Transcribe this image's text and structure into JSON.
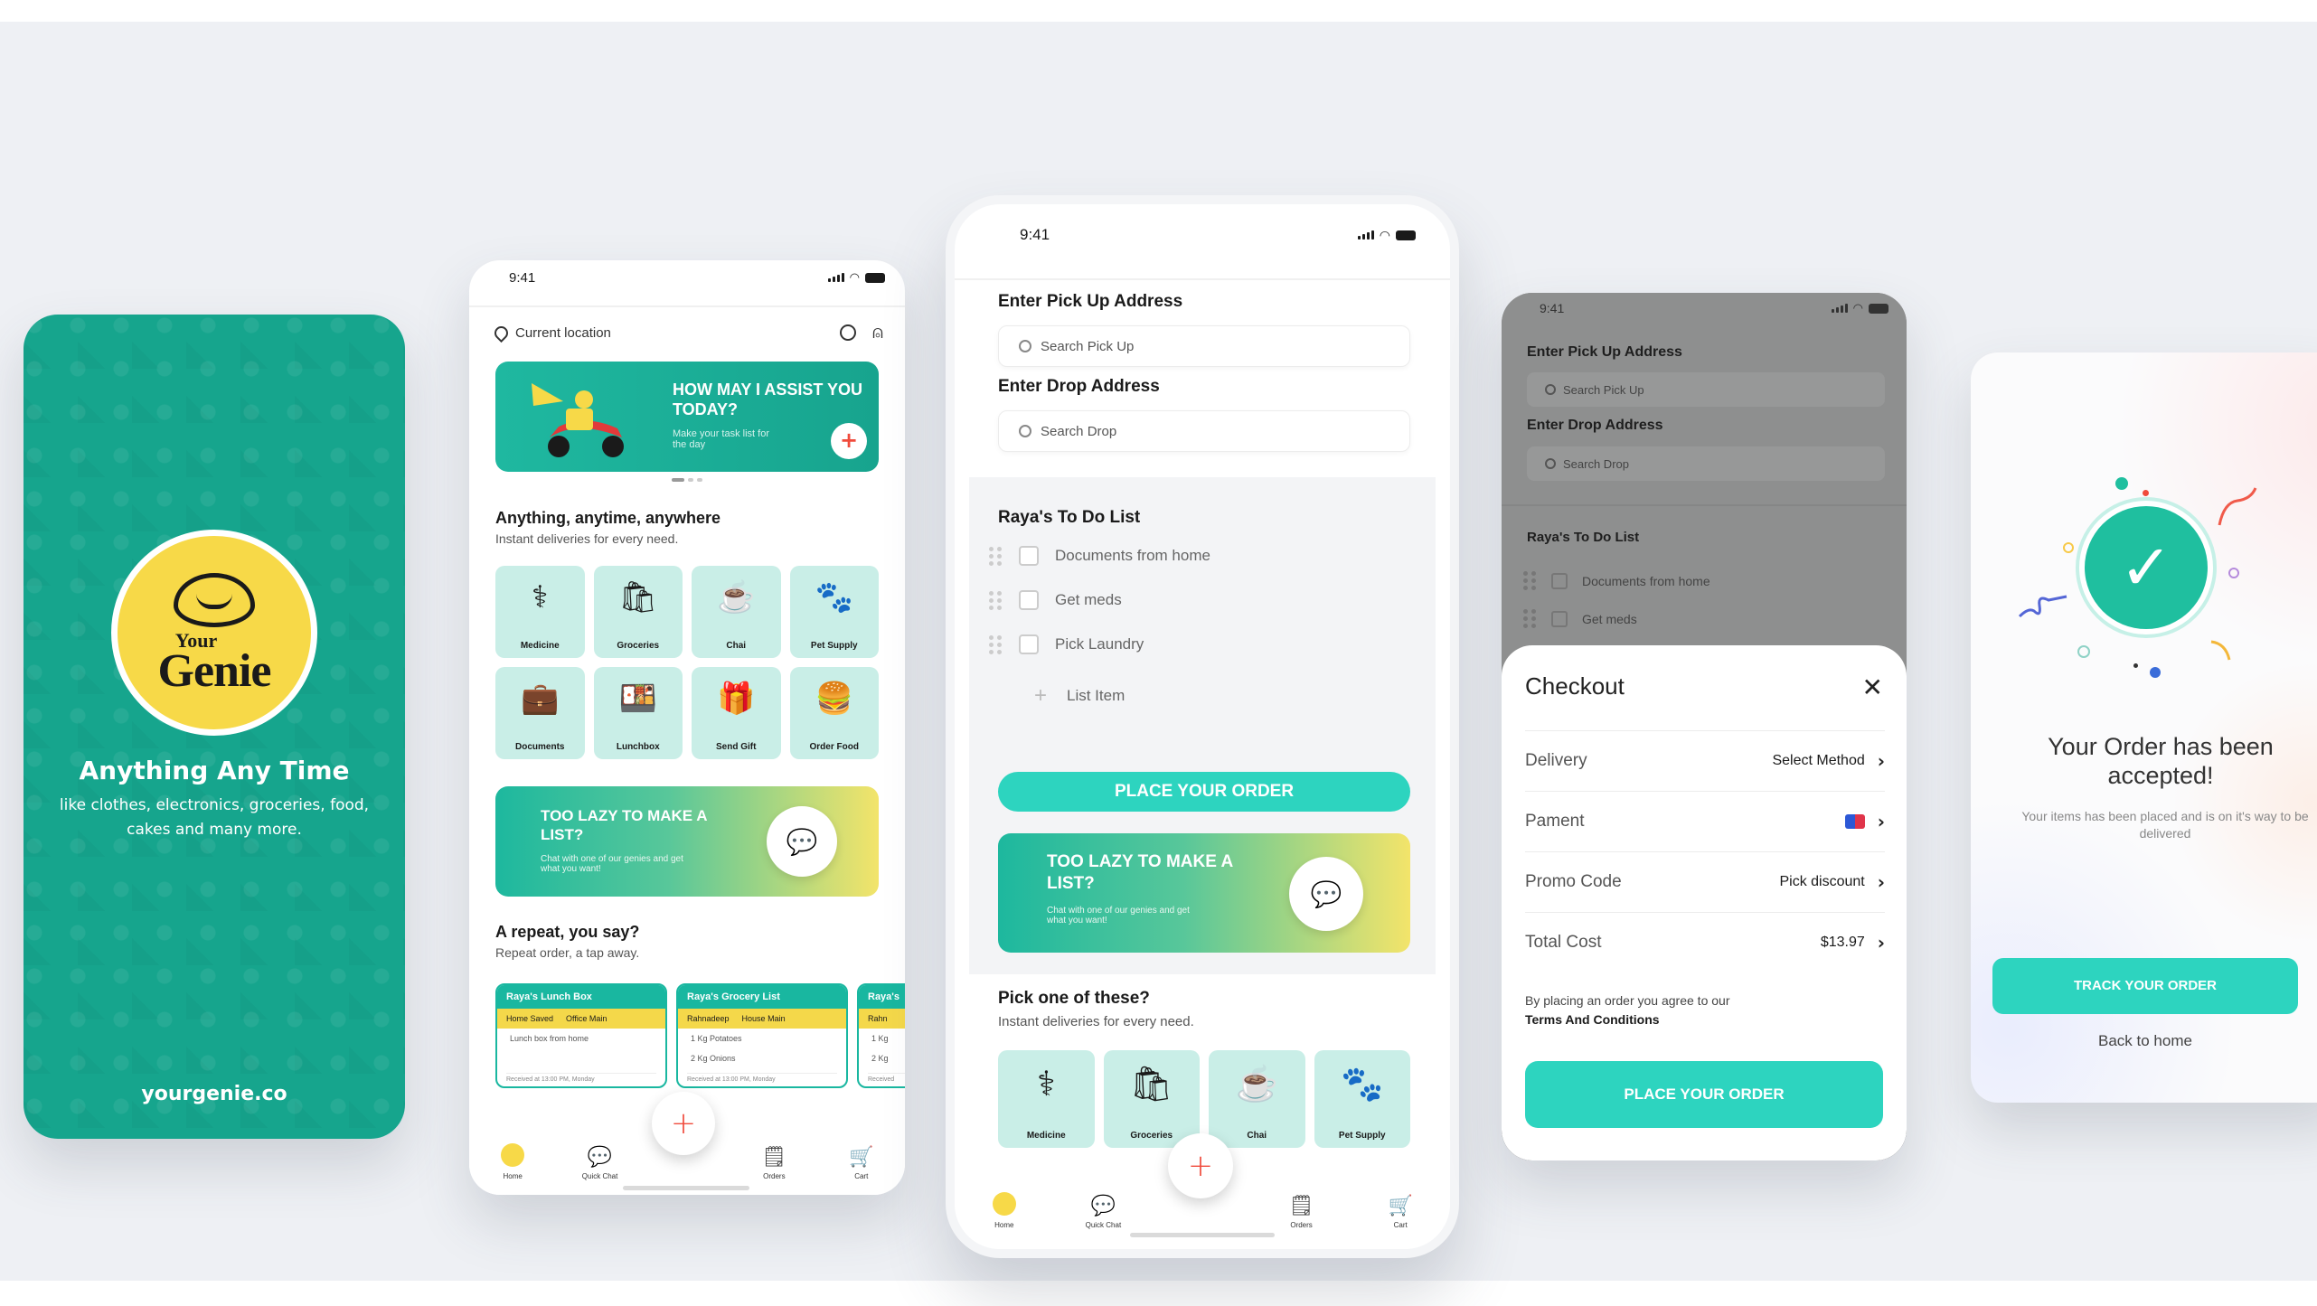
{
  "colors": {
    "brand_teal": "#16a58d",
    "accent_mint": "#2dd4bf",
    "genie_yellow": "#f7d948",
    "fab_red": "#f04b3c"
  },
  "splash": {
    "tagline": "Anything Any Time",
    "subline": "like clothes, electronics, groceries, food, cakes and many more.",
    "url": "yourgenie.co",
    "logo_top": "Your",
    "logo_bottom": "Genie"
  },
  "home": {
    "time": "9:41",
    "location": "Current location",
    "banner": {
      "title": "HOW MAY I ASSIST YOU TODAY?",
      "sub": "Make your task list for the day",
      "plus": "+"
    },
    "section1": {
      "title": "Anything, anytime, anywhere",
      "sub": "Instant deliveries for every need."
    },
    "categories": [
      {
        "label": "Medicine",
        "icon": "medicine-icon"
      },
      {
        "label": "Groceries",
        "icon": "groceries-icon"
      },
      {
        "label": "Chai",
        "icon": "chai-icon"
      },
      {
        "label": "Pet Supply",
        "icon": "pet-supply-icon"
      },
      {
        "label": "Documents",
        "icon": "documents-icon"
      },
      {
        "label": "Lunchbox",
        "icon": "lunchbox-icon"
      },
      {
        "label": "Send Gift",
        "icon": "gift-icon"
      },
      {
        "label": "Order Food",
        "icon": "order-food-icon"
      }
    ],
    "lazy": {
      "title": "TOO LAZY TO MAKE A LIST?",
      "sub": "Chat with one of our genies and get what you want!"
    },
    "repeat": {
      "title": "A repeat, you say?",
      "sub": "Repeat order, a tap away."
    },
    "repeat_cards": [
      {
        "title": "Raya's Lunch Box",
        "tag1": "Home Saved",
        "tag2": "Office Main",
        "lines": [
          "Lunch box from home"
        ],
        "footer": "Received at 13:00 PM, Monday"
      },
      {
        "title": "Raya's Grocery List",
        "tag1": "Rahnadeep",
        "tag2": "House Main",
        "lines": [
          "1 Kg Potatoes",
          "2 Kg Onions"
        ],
        "footer": "Received at 13:00 PM, Monday"
      },
      {
        "title": "Raya's",
        "tag1": "Rahn",
        "tag2": "",
        "lines": [
          "1 Kg",
          "2 Kg"
        ],
        "footer": "Received"
      }
    ],
    "tabs": [
      {
        "label": "Home"
      },
      {
        "label": "Quick Chat"
      },
      {
        "label": "Orders"
      },
      {
        "label": "Cart"
      }
    ],
    "fab": "+"
  },
  "order": {
    "time": "9:41",
    "pickup_title": "Enter Pick Up Address",
    "pickup_placeholder": "Search Pick Up",
    "drop_title": "Enter Drop Address",
    "drop_placeholder": "Search Drop",
    "todo_title": "Raya's To Do List",
    "todo_items": [
      "Documents from home",
      "Get meds",
      "Pick Laundry"
    ],
    "add_item": "List Item",
    "place_order": "PLACE YOUR ORDER",
    "lazy": {
      "title": "TOO LAZY TO MAKE A LIST?",
      "sub": "Chat with one of our genies and get what you want!"
    },
    "pick_title": "Pick one of these?",
    "pick_sub": "Instant deliveries for every need.",
    "categories": [
      "Medicine",
      "Groceries",
      "Chai",
      "Pet Supply"
    ],
    "tabs": [
      "Home",
      "Quick Chat",
      "Orders",
      "Cart"
    ],
    "fab": "+"
  },
  "checkout": {
    "time": "9:41",
    "pickup_title": "Enter Pick Up Address",
    "pickup_placeholder": "Search Pick Up",
    "drop_title": "Enter Drop Address",
    "drop_placeholder": "Search Drop",
    "todo_title": "Raya's To Do List",
    "todo_items": [
      "Documents from home",
      "Get meds"
    ],
    "title": "Checkout",
    "close": "✕",
    "rows": [
      {
        "label": "Delivery",
        "value": "Select Method"
      },
      {
        "label": "Pament",
        "value": ""
      },
      {
        "label": "Promo Code",
        "value": "Pick discount"
      },
      {
        "label": "Total Cost",
        "value": "$13.97"
      }
    ],
    "terms_prefix": "By placing an order you agree to our",
    "terms_link": "Terms And Conditions",
    "button": "PLACE YOUR ORDER"
  },
  "accepted": {
    "title": "Your Order has been accepted!",
    "sub": "Your items has been placed and is on it's way to be delivered",
    "track": "TRACK YOUR ORDER",
    "back": "Back to home"
  }
}
